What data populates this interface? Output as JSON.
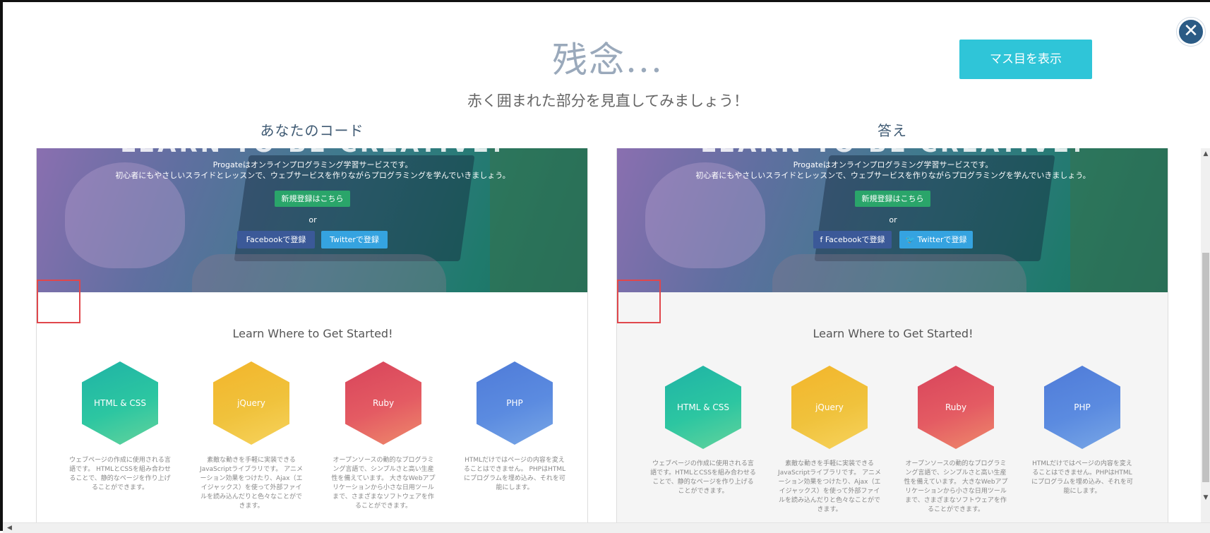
{
  "header": {
    "title": "残念...",
    "subtitle": "赤く囲まれた部分を見直してみましょう！",
    "grid_button": "マス目を表示",
    "close_icon": "close-icon"
  },
  "columns": {
    "mine_label": "あなたのコード",
    "answer_label": "答え"
  },
  "preview": {
    "hero_heading": "LEARN TO BE CREATIVE!",
    "hero_line1": "Progateはオンラインプログラミング学習サービスです。",
    "hero_line2": "初心者にもやさしいスライドとレッスンで、ウェブサービスを作りながらプログラミングを学んでいきましょう。",
    "signup_button": "新規登録はこちら",
    "or_text": "or",
    "facebook_button": "Facebookで登録",
    "twitter_button": "Twitterで登録",
    "facebook_button_answer": " Facebookで登録",
    "twitter_button_answer": " Twitterで登録",
    "learn_heading": "Learn Where to Get Started!",
    "courses": [
      {
        "name": "HTML & CSS",
        "desc": "ウェブページの作成に使用される言語です。 HTMLとCSSを組み合わせることで、静的なページを作り上げることができます。"
      },
      {
        "name": "jQuery",
        "desc": "素敵な動きを手軽に実装できるJavaScriptライブラリです。 アニメーション効果をつけたり、Ajax（エイジャックス）を使って外部ファイルを読み込んだりと色々なことができます。"
      },
      {
        "name": "Ruby",
        "desc": "オープンソースの動的なプログラミング言語で、シンプルさと高い生産性を備えています。 大きなWebアプリケーションから小さな日用ツールまで、さまざまなソフトウェアを作ることができます。"
      },
      {
        "name": "PHP",
        "desc": "HTMLだけではページの内容を変えることはできません。 PHPはHTMLにプログラムを埋め込み、それを可能にします。"
      }
    ],
    "courses_answer_desc": [
      "ウェブページの作成に使用される言語です。HTMLとCSSを組み合わせることで、静的なページを作り上げることができます。",
      "素敵な動きを手軽に実装できるJavaScriptライブラリです。 アニメーション効果をつけたり、Ajax（エイジャックス）を使って外部ファイルを読み込んだりと色々なことができます。",
      "オープンソースの動的なプログラミング言語で、シンプルさと高い生産性を備えています。 大きなWebアプリケーションから小さな日用ツールまで、さまざまなソフトウェアを作ることができます。",
      "HTMLだけではページの内容を変えることはできません。PHPはHTMLにプログラムを埋め込み、それを可能にします。"
    ]
  },
  "colors": {
    "accent": "#2fc5d8",
    "close": "#2b5b85",
    "error_outline": "#e0474c"
  }
}
